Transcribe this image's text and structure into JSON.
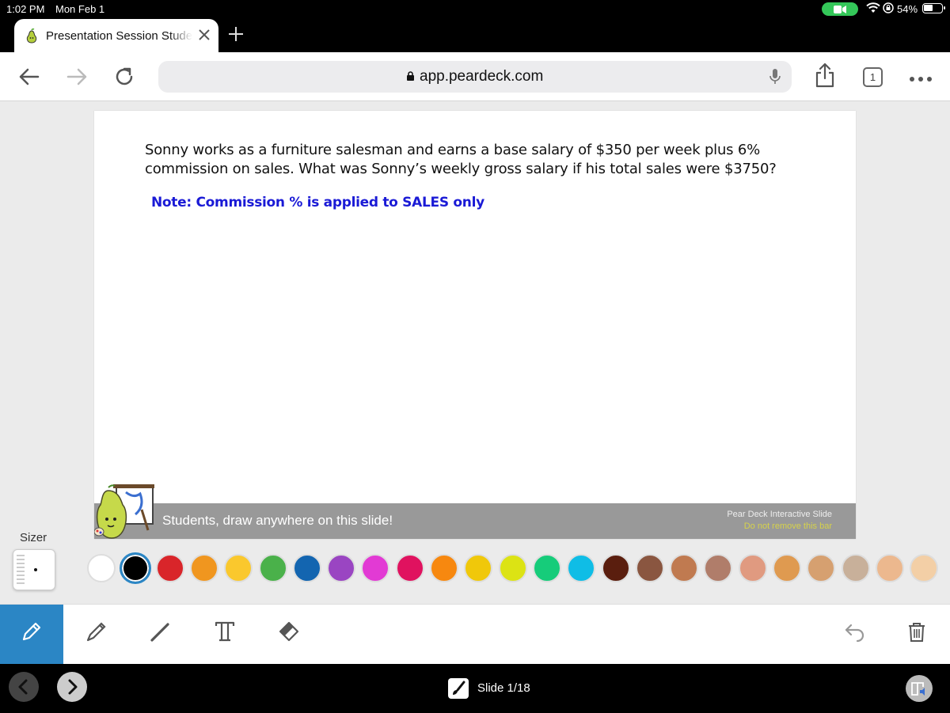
{
  "status_bar": {
    "time": "1:02 PM",
    "date": "Mon Feb 1",
    "battery": "54%"
  },
  "browser": {
    "tab_title": "Presentation Session Student",
    "url": "app.peardeck.com",
    "tab_count": "1"
  },
  "slide": {
    "question": "Sonny works as a furniture salesman and earns a base salary of $350 per week plus 6% commission on sales. What was Sonny’s weekly gross salary if his total sales were $3750?",
    "note": "Note: Commission % is applied to SALES only",
    "draw_bar_text": "Students, draw anywhere on this slide!",
    "pd_label": "Pear Deck Interactive Slide",
    "pd_sublabel": "Do not remove this bar"
  },
  "sizer": {
    "label": "Sizer"
  },
  "palette": {
    "colors": [
      "#ffffff",
      "#000000",
      "#d9252a",
      "#f0961f",
      "#fac82d",
      "#4ab14a",
      "#1365b0",
      "#9a45c2",
      "#e23ad4",
      "#e0125f",
      "#f7880f",
      "#f0c80a",
      "#dce314",
      "#16cc7a",
      "#0fbde6",
      "#5a1e0e",
      "#8a5640",
      "#c07a50",
      "#b07d6a",
      "#e09a80",
      "#df9a50",
      "#d6a070",
      "#c8b09a",
      "#ecb88e",
      "#f3cfa6"
    ],
    "selected_index": 1
  },
  "footer": {
    "slide_indicator": "Slide 1/18"
  }
}
